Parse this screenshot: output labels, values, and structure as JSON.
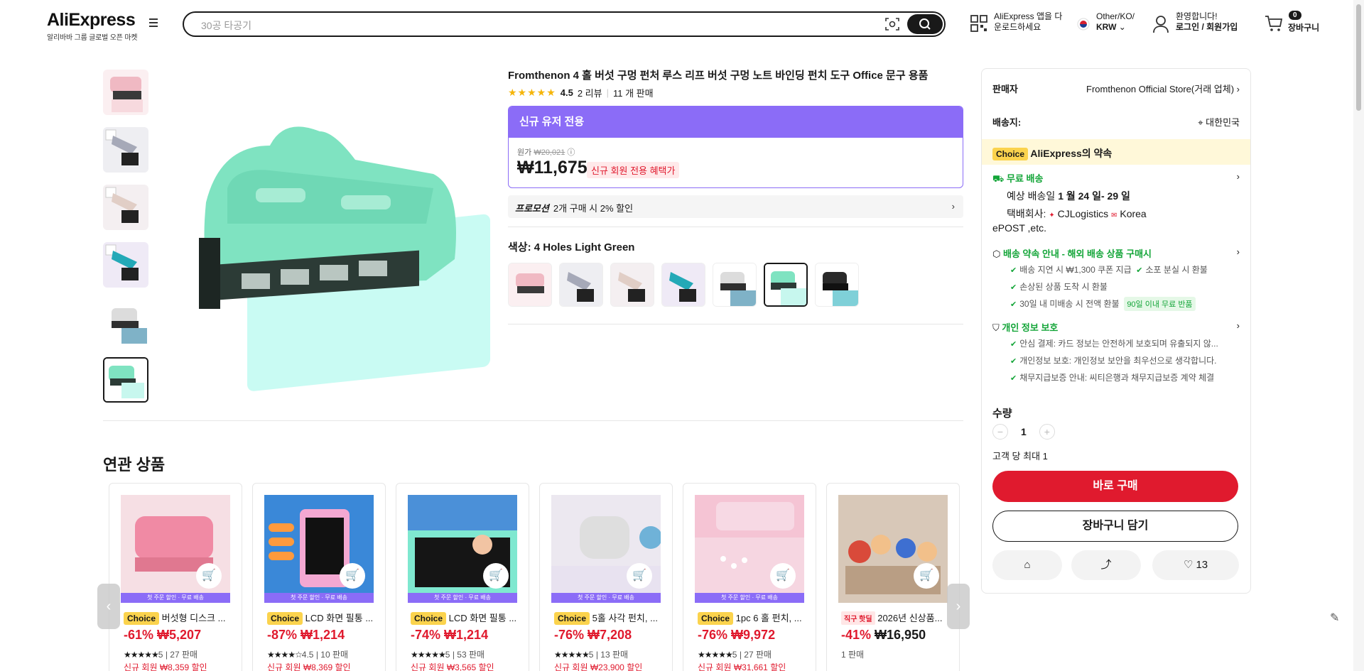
{
  "header": {
    "logo": "AliExpress",
    "logo_sub": "알리바바 그룹 글로벌 오픈 마켓",
    "search_placeholder": "30공 타공기",
    "app_line1": "AliExpress 앱을 다",
    "app_line2": "운로드하세요",
    "region_line1": "Other/KO/",
    "region_line2": "KRW",
    "welcome": "환영합니다!",
    "login": "로그인 / 회원가입",
    "cart_count": "0",
    "cart_label": "장바구니"
  },
  "product": {
    "title": "Fromthenon 4 홀 버섯 구멍 펀처 루스 리프 버섯 구멍 노트 바인딩 펀치 도구 Office 문구 용품",
    "stars": "★★★★★",
    "rating": "4.5",
    "reviews": "2 리뷰",
    "sold": "11 개 판매",
    "promo_header": "신규 유저 전용",
    "orig_label": "원가",
    "orig_price": "₩20,021",
    "price": "₩11,675",
    "price_tag": "신규 회원 전용 혜택가",
    "promotion_label": "프로모션",
    "promotion_text": "2개 구매 시 2% 할인",
    "color_label": "색상: 4 Holes Light Green"
  },
  "side": {
    "seller_label": "판매자",
    "seller_name": "Fromthenon Official Store(거래 업체)",
    "ship_label": "배송지:",
    "ship_to": "대한민국",
    "choice_badge": "Choice",
    "choice_text": "AliExpress의 약속",
    "free_ship": "무료 배송",
    "eta_prefix": "예상 배송일",
    "eta": "1 월 24 일- 29 일",
    "carrier_label": "택배회사:",
    "carrier1": "CJLogistics",
    "carrier2": "Korea",
    "carrier3": "ePOST ,etc.",
    "promise_title": "배송 약속 안내 - 해외 배송 상품 구매시",
    "promise_1a": "배송 지연 시 ₩1,300 쿠폰 지급",
    "promise_1b": "소포 분실 시 환불",
    "promise_2": "손상된 상품 도착 시 환불",
    "promise_3": "30일 내 미배송 시 전액 환불",
    "promise_3_badge": "90일 이내 무료 반품",
    "privacy_title": "개인 정보 보호",
    "privacy_1": "안심 결제: 카드 정보는 안전하게 보호되며 유출되지 않...",
    "privacy_2": "개인정보 보호: 개인정보 보안을 최우선으로 생각합니다.",
    "privacy_3": "채무지급보증 안내: 씨티은행과 채무지급보증 계약 체결",
    "qty_label": "수량",
    "qty_value": "1",
    "qty_limit": "고객 당 최대 1",
    "buy_now": "바로 구매",
    "add_cart": "장바구니 담기",
    "wish_count": "13"
  },
  "related": {
    "title": "연관 상품",
    "strip": "첫 주문 할인 · 무료 배송",
    "items": [
      {
        "badge": "Choice",
        "name": "버섯형 디스크 ...",
        "discount": "-61%",
        "price": "₩5,207",
        "stars": "★★★★★",
        "rate": "5",
        "sold": "27 판매",
        "promo": "신규 회원 ₩8,359 할인"
      },
      {
        "badge": "Choice",
        "name": "LCD 화면 필통 ...",
        "discount": "-87%",
        "price": "₩1,214",
        "stars": "★★★★☆",
        "rate": "4.5",
        "sold": "10 판매",
        "promo": "신규 회원 ₩8,369 할인"
      },
      {
        "badge": "Choice",
        "name": "LCD 화면 필통 ...",
        "discount": "-74%",
        "price": "₩1,214",
        "stars": "★★★★★",
        "rate": "5",
        "sold": "53 판매",
        "promo": "신규 회원 ₩3,565 할인"
      },
      {
        "badge": "Choice",
        "name": "5홀 사각 펀치, ...",
        "discount": "-76%",
        "price": "₩7,208",
        "stars": "★★★★★",
        "rate": "5",
        "sold": "13 판매",
        "promo": "신규 회원 ₩23,900 할인"
      },
      {
        "badge": "Choice",
        "name": "1pc 6 홀 펀치, ...",
        "discount": "-76%",
        "price": "₩9,972",
        "stars": "★★★★★",
        "rate": "5",
        "sold": "27 판매",
        "promo": "신규 회원 ₩31,661 할인"
      },
      {
        "badge": "직구 핫딜",
        "name": "2026년 신상품...",
        "discount": "-41%",
        "price": "₩16,950",
        "sold": "1 판매"
      }
    ]
  }
}
